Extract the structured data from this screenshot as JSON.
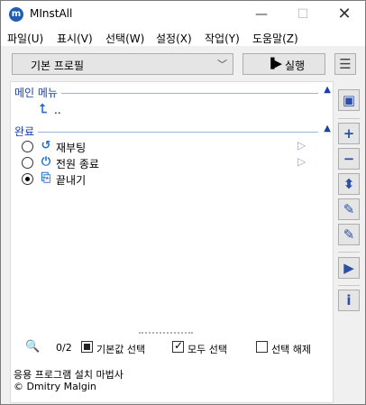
{
  "window": {
    "title": "MInstAll",
    "icon_letter": "m",
    "controls": {
      "minimize": "—",
      "maximize": "☐",
      "close": "✕"
    }
  },
  "menu": {
    "items": [
      "파일(U)",
      "표시(V)",
      "선택(W)",
      "설정(X)",
      "작업(Y)",
      "도움말(Z)"
    ]
  },
  "toolbar": {
    "profile_value": "기본 프로필",
    "run_label": "실행",
    "run_icon": "▐▶",
    "menu_icon": "☰"
  },
  "groups": {
    "main_menu": {
      "label": "메인 메뉴",
      "collapse_icon": "▲",
      "updir_icon": "⮤",
      "updir_label": ".."
    },
    "done": {
      "label": "완료",
      "collapse_icon": "▲",
      "items": [
        {
          "label": "재부팅",
          "icon": "↺",
          "checked": false,
          "arrow": "▷"
        },
        {
          "label": "전원 종료",
          "icon": "⏻",
          "checked": false,
          "arrow": "▷"
        },
        {
          "label": "끝내기",
          "icon": "⎘",
          "checked": true,
          "arrow": ""
        }
      ]
    }
  },
  "status": {
    "search_icon": "🔍",
    "count": "0/2",
    "default_select_label": "기본값 선택",
    "select_all_label": "모두 선택",
    "deselect_label": "선택 해제"
  },
  "footer": {
    "line1": "응용 프로그램 설치 마법사",
    "line2": "© Dmitry Malgin"
  },
  "side_buttons": {
    "save": "▣",
    "add": "+",
    "remove": "−",
    "move": "⬍",
    "edit": "✎",
    "edit2": "✎",
    "play": "▶",
    "info": "i"
  },
  "colors": {
    "accent": "#1a3fa6",
    "icon_blue": "#1e6fd0"
  }
}
